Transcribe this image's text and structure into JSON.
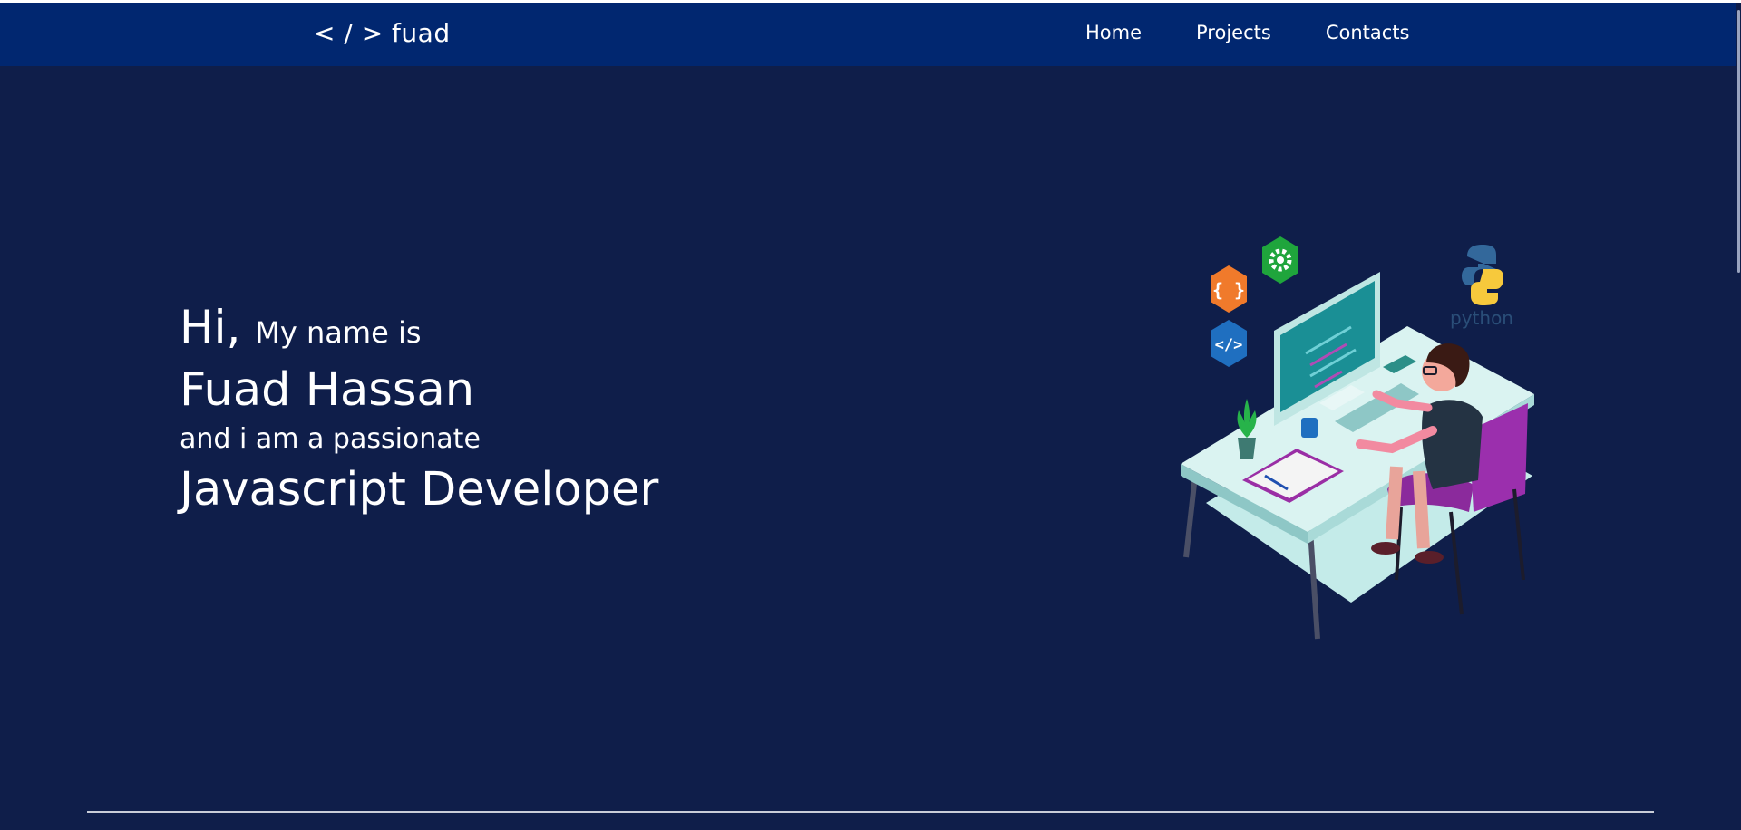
{
  "brand": {
    "logo": "< / > fuad"
  },
  "nav": {
    "items": [
      {
        "label": "Home"
      },
      {
        "label": "Projects"
      },
      {
        "label": "Contacts"
      }
    ]
  },
  "hero": {
    "greeting": "Hi,",
    "intro": "My name is",
    "name": "Fuad Hassan",
    "tagline": "and i am a passionate",
    "role": "Javascript Developer"
  },
  "illustration": {
    "python_label": "python",
    "icons": [
      "curly-braces-icon",
      "gear-icon",
      "code-tag-icon",
      "python-logo-icon"
    ]
  },
  "colors": {
    "background": "#0f1e4a",
    "navbar": "#012770",
    "text": "#ffffff",
    "chair": "#8b2a9c",
    "desk": "#cdeeed"
  }
}
